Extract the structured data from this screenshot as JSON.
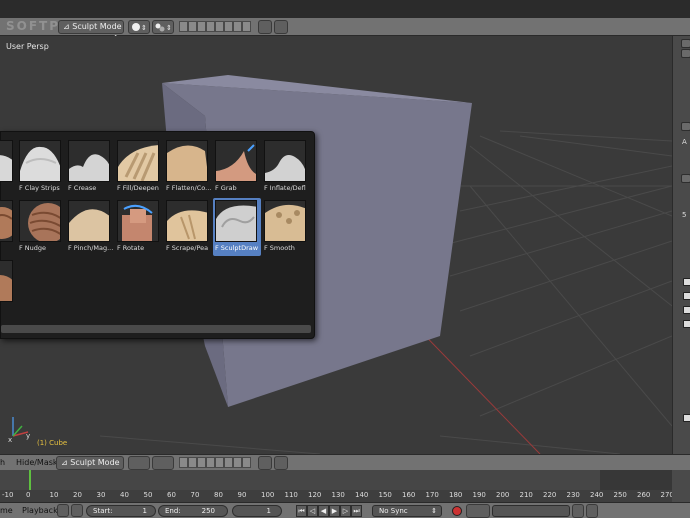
{
  "header": {
    "mode": "Sculpt Mode",
    "watermark": "SOFTPEDIA"
  },
  "viewport": {
    "view_label": "User Persp",
    "object_label": "(1) Cube"
  },
  "brushes": [
    {
      "name": "F Clay Strips"
    },
    {
      "name": "F Crease"
    },
    {
      "name": "F Fill/Deepen"
    },
    {
      "name": "F Flatten/Co..."
    },
    {
      "name": "F Grab"
    },
    {
      "name": "F Inflate/Defl"
    },
    {
      "name": "F Nudge"
    },
    {
      "name": "F Pinch/Mag..."
    },
    {
      "name": "F Rotate"
    },
    {
      "name": "F Scrape/Pea"
    },
    {
      "name": "F SculptDraw",
      "selected": true
    },
    {
      "name": "F Smooth"
    }
  ],
  "bottom_header": {
    "menu_partial": "h",
    "hide_mask": "Hide/Mask",
    "mode": "Sculpt Mode"
  },
  "timeline": {
    "ticks": [
      "0",
      "10",
      "20",
      "30",
      "40",
      "50",
      "60",
      "70",
      "80",
      "90",
      "100",
      "110",
      "120",
      "130",
      "140",
      "150",
      "160",
      "170",
      "180",
      "190",
      "200",
      "210",
      "220",
      "230",
      "240",
      "250",
      "260",
      "270",
      "280"
    ],
    "leading_tick": "-10",
    "current_frame": 1
  },
  "footer": {
    "menu_partial": "me",
    "playback": "Playback",
    "start_label": "Start:",
    "start_value": "1",
    "end_label": "End:",
    "end_value": "250",
    "current_value": "1",
    "sync": "No Sync"
  },
  "right_panel": {
    "glyphs": [
      "A",
      "5"
    ]
  }
}
